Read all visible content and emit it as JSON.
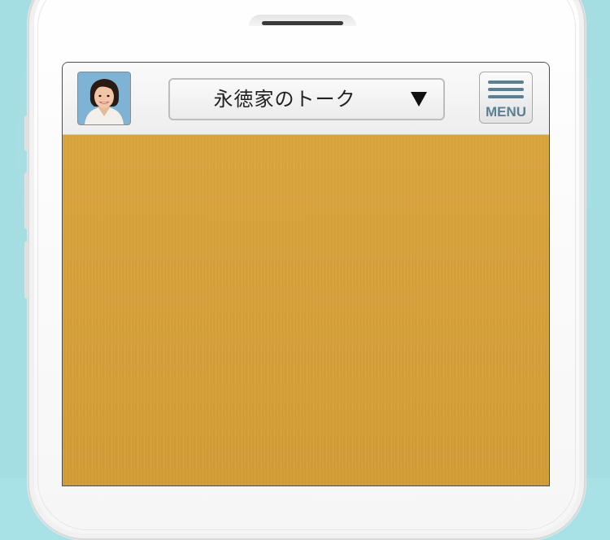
{
  "header": {
    "title": "永徳家のトーク",
    "menu_label": "MENU"
  },
  "icons": {
    "avatar": "user-avatar-photo",
    "dropdown": "triangle-down-icon",
    "menu": "hamburger-menu-icon"
  },
  "colors": {
    "background": "#a9e2e6",
    "chat_background": "#d39f37",
    "menu_accent": "#5b8093"
  }
}
